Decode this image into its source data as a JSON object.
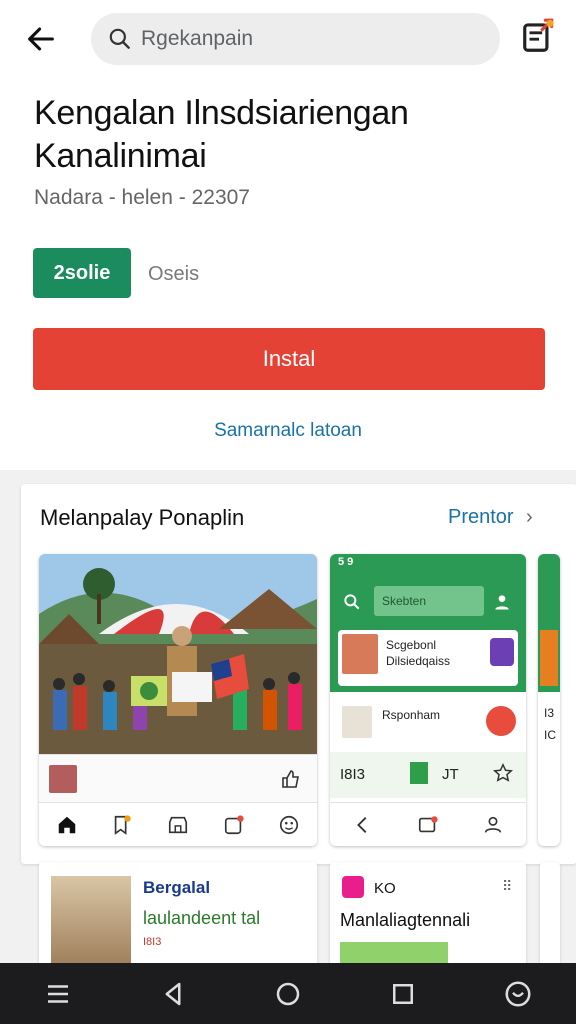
{
  "header": {
    "search_text": "Rgekanpain"
  },
  "app": {
    "title": "Kengalan Ilnsdsiariengan Kanalinimai",
    "subtitle": "Nadara - helen - 22307",
    "chip_label": "2solie",
    "chip_side": "Oseis",
    "install_label": "Instal",
    "link_label": "Samarnalc latoan"
  },
  "section": {
    "title": "Melanpalay Ponaplin",
    "more_label": "Prentor",
    "chevron": "›"
  },
  "screens": {
    "s2_status": "5 9",
    "s2_search": "Skebten",
    "s2_item1_line1": "Scgebonl",
    "s2_item1_line2": "Dilsiedqaiss",
    "s2_item2": "Rsponham",
    "s2_row3_text": "I8I3",
    "s2_row3_mid": "JT",
    "s3_left1": "I3",
    "s3_left2": "IC"
  },
  "cards": {
    "c1_title": "Bergalal",
    "c1_sub": "laulandeent tal",
    "c1_tag": "I8I3",
    "c2_title": "KO",
    "c2_sub": "Manlaliagtennali"
  },
  "colors": {
    "accent_green": "#1a8c5e",
    "install_red": "#e34234",
    "link_blue": "#1a73a8",
    "app_green": "#2b9a55"
  }
}
